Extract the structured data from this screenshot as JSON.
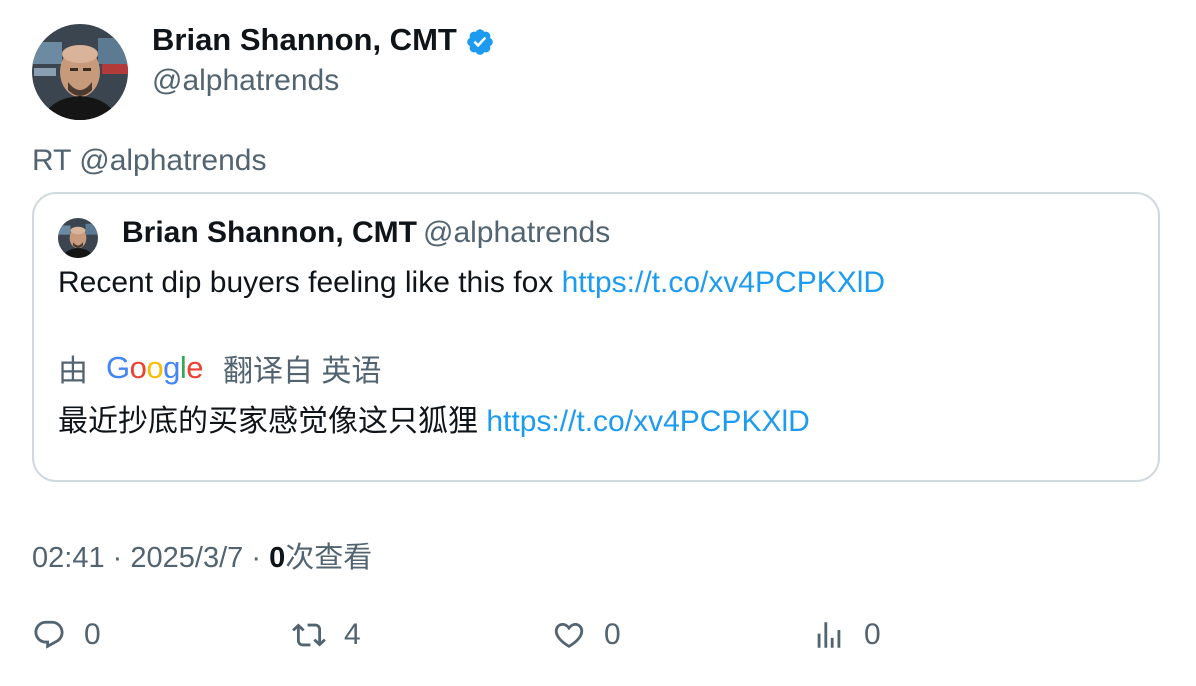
{
  "tweet": {
    "author": {
      "name": "Brian Shannon, CMT",
      "handle": "@alphatrends",
      "verified_icon": "verified-badge-icon",
      "verified_color": "#1d9bf0"
    },
    "retweet_text": "RT @alphatrends",
    "quote": {
      "author_name": "Brian Shannon, CMT",
      "author_handle": "@alphatrends",
      "text": "Recent dip buyers feeling like this fox ",
      "link": "https://t.co/xv4PCPKXlD",
      "translation": {
        "prefix": "由",
        "provider_logo": "Google",
        "suffix": "翻译自 英语",
        "text": "最近抄底的买家感觉像这只狐狸 ",
        "link": "https://t.co/xv4PCPKXlD"
      }
    },
    "meta": {
      "time": "02:41",
      "separator": "·",
      "date": "2025/3/7",
      "views_count": "0",
      "views_label": "次查看"
    },
    "actions": {
      "reply": {
        "icon": "reply-icon",
        "count": "0"
      },
      "retweet": {
        "icon": "retweet-icon",
        "count": "4"
      },
      "like": {
        "icon": "heart-icon",
        "count": "0"
      },
      "views": {
        "icon": "analytics-icon",
        "count": "0"
      }
    },
    "colors": {
      "text_primary": "#0f1419",
      "text_secondary": "#536471",
      "link": "#1d9bf0",
      "border": "#cfd9de"
    }
  }
}
